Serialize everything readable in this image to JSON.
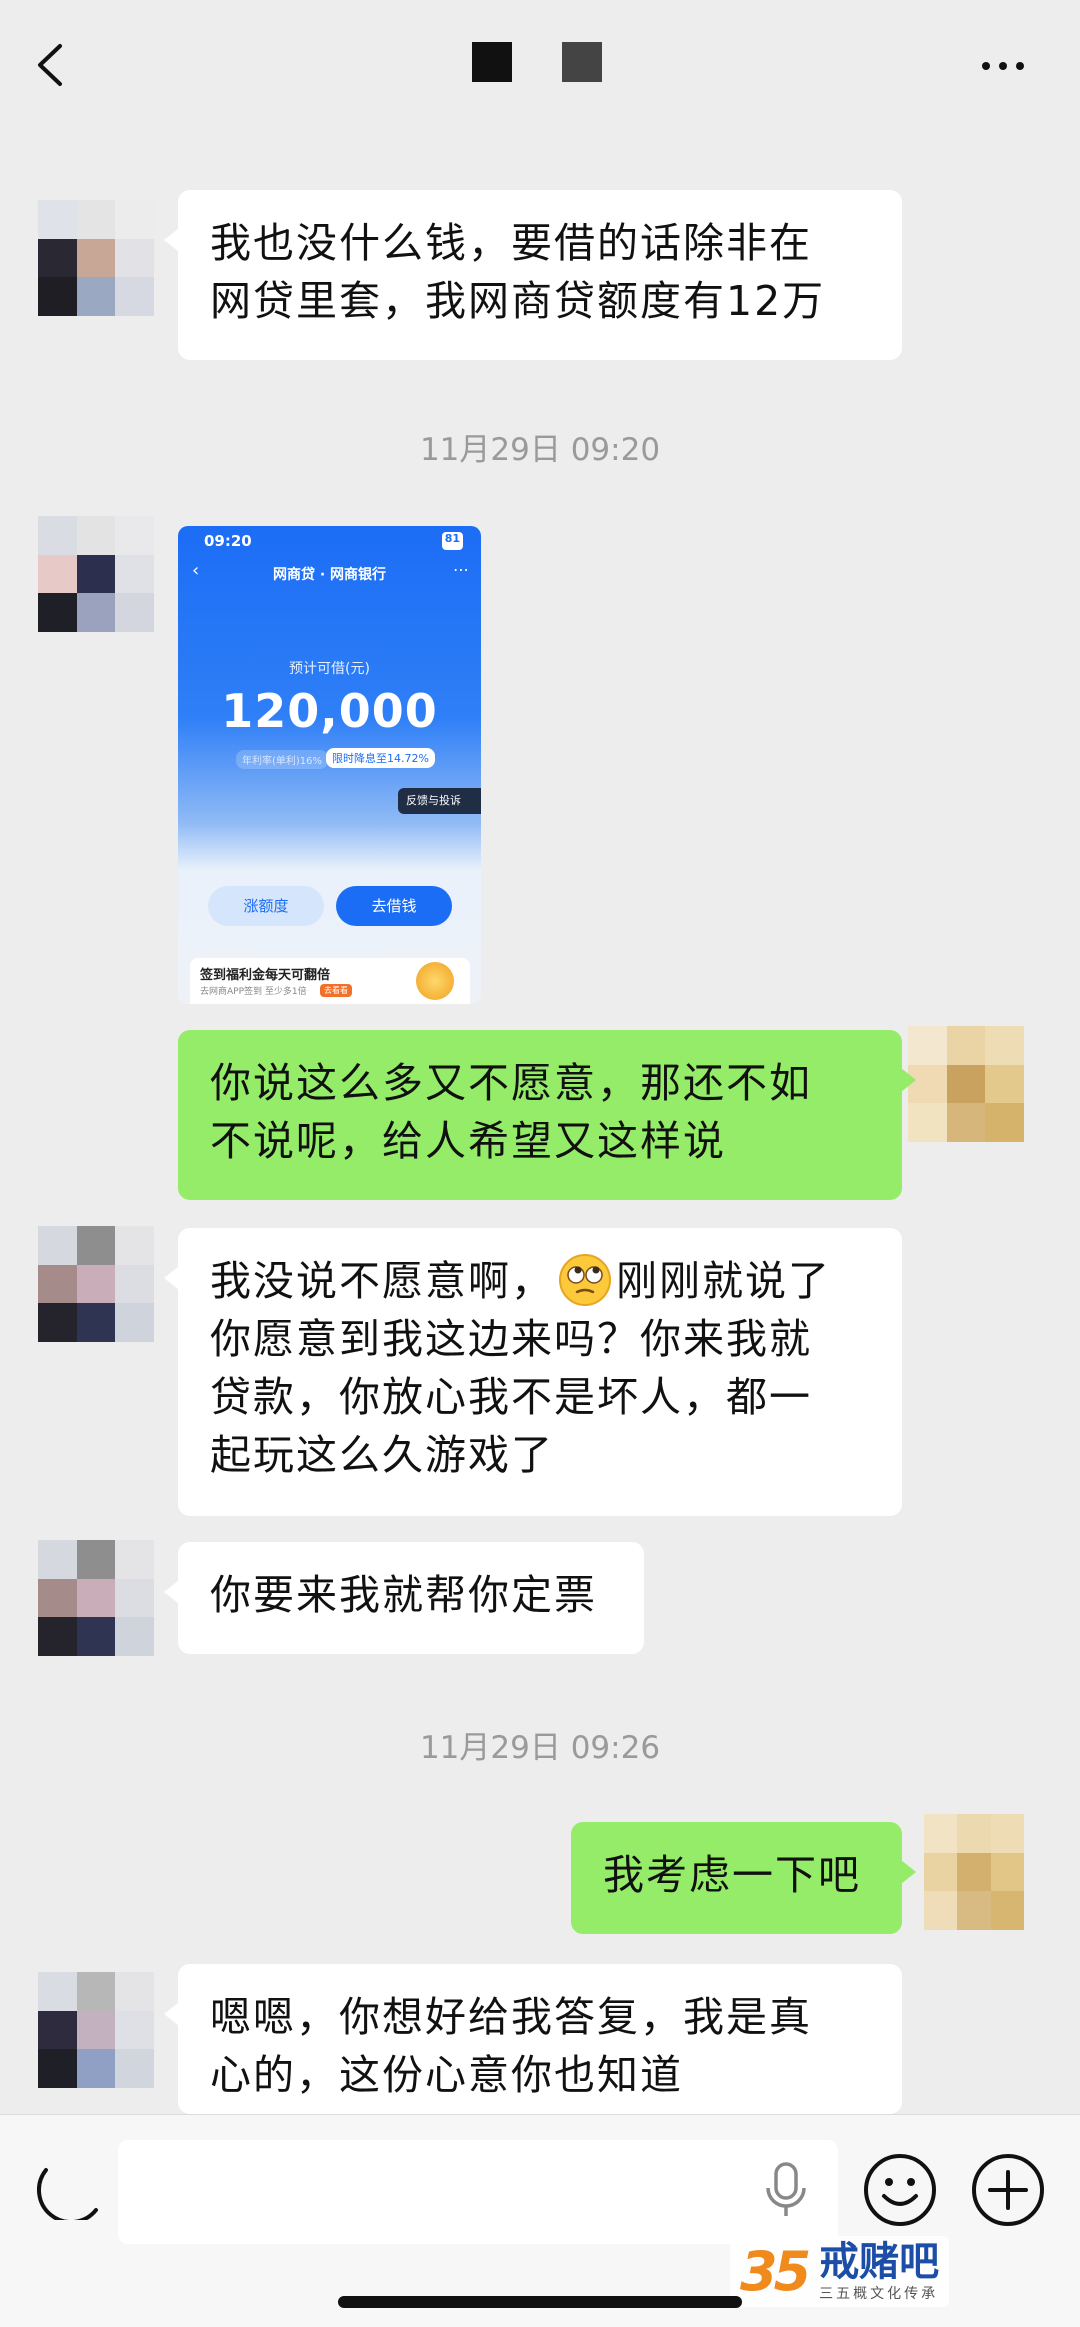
{
  "header": {
    "back_icon": "chevron-left-icon",
    "more_icon": "more-dots-icon"
  },
  "messages": [
    {
      "side": "left",
      "text_lines": [
        "我也没什么钱，要借的话除非在",
        "网贷里套，我网商贷额度有12万"
      ]
    },
    {
      "timestamp": "11月29日 09:20"
    },
    {
      "side": "left",
      "type": "image"
    },
    {
      "side": "right",
      "text_lines": [
        "你说这么多又不愿意，那还不如",
        "不说呢，给人希望又这样说"
      ]
    },
    {
      "side": "left",
      "text_lines": [
        "我没说不愿意啊，",
        "刚刚就说了",
        "你愿意到我这边来吗？你来我就",
        "贷款，你放心我不是坏人，都一",
        "起玩这么久游戏了"
      ]
    },
    {
      "side": "left",
      "text_lines": [
        "你要来我就帮你定票"
      ]
    },
    {
      "timestamp": "11月29日 09:26"
    },
    {
      "side": "right",
      "text_lines": [
        "我考虑一下吧"
      ]
    },
    {
      "side": "left",
      "text_lines": [
        "嗯嗯，你想好给我答复，我是真",
        "心的，这份心意你也知道"
      ]
    }
  ],
  "shared_image": {
    "status_time": "09:20",
    "status_battery": "81",
    "title": "网商贷 · 网商银行",
    "label": "预计可借(元)",
    "amount": "120,000",
    "chip_left": "年利率(单利)16%",
    "chip_right": "限时降息至14.72%",
    "feedback": "反馈与投诉",
    "btn_increase": "涨额度",
    "btn_borrow": "去借钱",
    "banner_title": "签到福利金每天可翻倍",
    "banner_sub": "去网商APP签到 至少多1倍",
    "banner_tag": "去看看"
  },
  "input_bar": {
    "voice_icon": "voice-icon",
    "mic_icon": "mic-icon",
    "emoji_icon": "smile-icon",
    "plus_icon": "plus-icon"
  },
  "watermark": {
    "logo": "35",
    "name": "戒赌吧",
    "sub": "三五概文化传承"
  },
  "colors": {
    "bubble_green": "#95ec69",
    "bubble_white": "#ffffff",
    "background": "#ededed"
  }
}
